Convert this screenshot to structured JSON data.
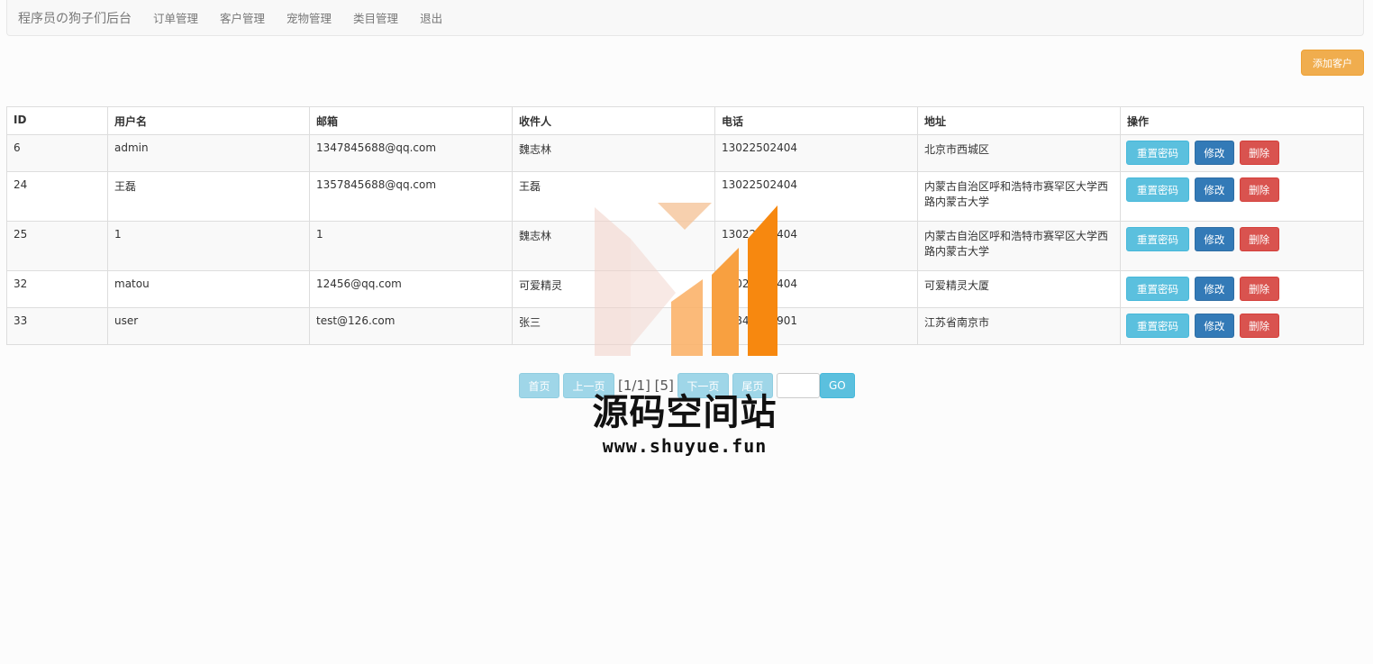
{
  "navbar": {
    "brand": "程序员の狗子们后台",
    "links": [
      "订单管理",
      "客户管理",
      "宠物管理",
      "类目管理",
      "退出"
    ]
  },
  "add_button": "添加客户",
  "table": {
    "headers": [
      "ID",
      "用户名",
      "邮箱",
      "收件人",
      "电话",
      "地址",
      "操作"
    ],
    "rows": [
      {
        "id": "6",
        "username": "admin",
        "email": "1347845688@qq.com",
        "recipient": "魏志林",
        "phone": "13022502404",
        "address": "北京市西城区"
      },
      {
        "id": "24",
        "username": "王磊",
        "email": "1357845688@qq.com",
        "recipient": "王磊",
        "phone": "13022502404",
        "address": "内蒙古自治区呼和浩特市赛罕区大学西路内蒙古大学"
      },
      {
        "id": "25",
        "username": "1",
        "email": "1",
        "recipient": "魏志林",
        "phone": "13022502404",
        "address": "内蒙古自治区呼和浩特市赛罕区大学西路内蒙古大学"
      },
      {
        "id": "32",
        "username": "matou",
        "email": "12456@qq.com",
        "recipient": "可爱精灵",
        "phone": "13022502404",
        "address": "可爱精灵大厦"
      },
      {
        "id": "33",
        "username": "user",
        "email": "test@126.com",
        "recipient": "张三",
        "phone": "18845669901",
        "address": "江苏省南京市"
      }
    ],
    "actions": {
      "reset": "重置密码",
      "edit": "修改",
      "delete": "删除"
    }
  },
  "pager": {
    "first": "首页",
    "prev": "上一页",
    "info": "[1/1] [5]",
    "next": "下一页",
    "last": "尾页",
    "go": "GO"
  },
  "watermark": {
    "title": "源码空间站",
    "url": "www.shuyue.fun"
  },
  "colors": {
    "info": "#5bc0de",
    "primary": "#337ab7",
    "danger": "#d9534f",
    "warning": "#f0ad4e"
  }
}
